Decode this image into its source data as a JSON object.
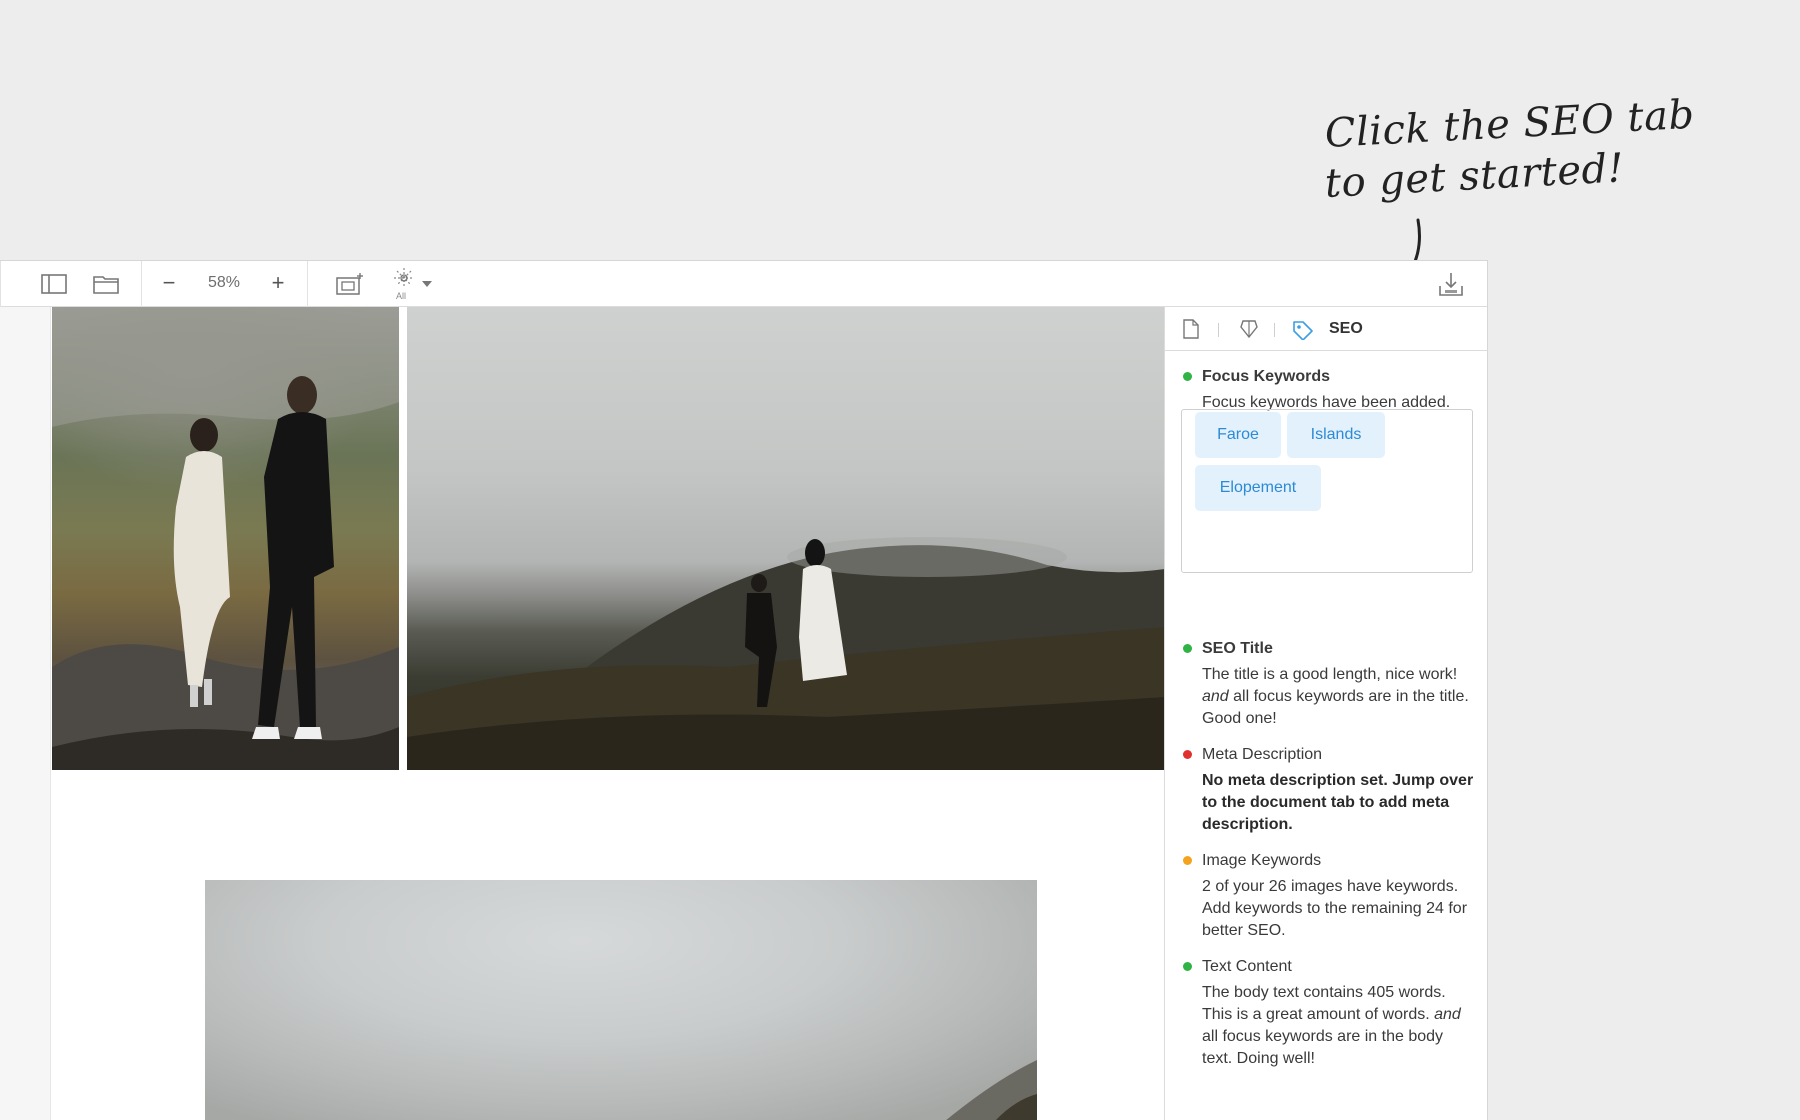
{
  "annotation": {
    "line1": "Click the SEO tab",
    "line2": "to get started!"
  },
  "toolbar": {
    "zoom": "58%",
    "zoom_out": "−",
    "zoom_in": "+",
    "all_label": "All"
  },
  "panel": {
    "active_tab": "SEO",
    "keywords": [
      "Faroe",
      "Islands",
      "Elopement"
    ],
    "sections": {
      "focus": {
        "status": "green",
        "title": "Focus Keywords",
        "text": "Focus keywords have been added. Great start!"
      },
      "seo_title": {
        "status": "green",
        "title": "SEO Title",
        "text_a": "The title is a good length, nice work! ",
        "text_em": "and",
        "text_b": " all focus keywords are in the title. Good one!"
      },
      "meta": {
        "status": "red",
        "title": "Meta Description",
        "text": "No meta description set. Jump over to the document tab to add meta description."
      },
      "image_keywords": {
        "status": "orange",
        "title": "Image Keywords",
        "text": "2 of your 26 images have keywords. Add keywords to the remaining 24 for better SEO."
      },
      "text_content": {
        "status": "green",
        "title": "Text Content",
        "text_a": "The body text contains 405 words. This is a great amount of words. ",
        "text_em": "and",
        "text_b": " all focus keywords are in the body text. Doing well!"
      }
    }
  },
  "colors": {
    "green": "#2fb345",
    "red": "#e0312f",
    "orange": "#f3a31c",
    "chip_bg": "#e3f1fc",
    "chip_text": "#2c8ad6",
    "seo_tag_icon": "#3b9fe3"
  },
  "icons": [
    "sidebar-toggle-icon",
    "folder-icon",
    "zoom-out-icon",
    "zoom-in-icon",
    "add-frame-icon",
    "sparkle-filter-icon",
    "chevron-down-icon",
    "export-icon",
    "document-icon",
    "award-icon",
    "tag-icon"
  ]
}
